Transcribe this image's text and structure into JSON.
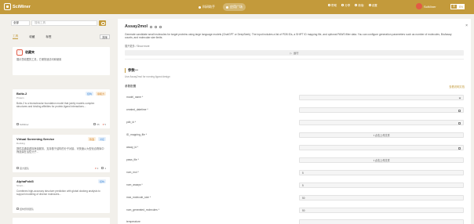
{
  "header": {
    "logo_text": "SciMiner",
    "nav": [
      {
        "label": "科研助手",
        "active": false
      },
      {
        "label": "应用广场",
        "active": true
      }
    ],
    "top_links": [
      "帮助",
      "分享",
      "新版",
      "设置"
    ],
    "user_name": "SciMiner",
    "lang": [
      "中",
      "EN"
    ]
  },
  "sidebar": {
    "search_select": "全部",
    "search_placeholder": "搜索工具",
    "tabs": [
      {
        "label": "工具",
        "active": true
      },
      {
        "label": "收藏",
        "active": false
      },
      {
        "label": "标签",
        "active": false
      }
    ],
    "sort_label": "排序",
    "favorites_card": {
      "title": "收藏夹",
      "desc": "展示您收藏的工具，方便快速访问和使用"
    },
    "cards": [
      {
        "title": "Boltz-2",
        "subtitle": "Protein",
        "desc": "Boltz-2 is a biomolecular foundation model that jointly models complex structures and binding affinities for protein-ligand interactions...",
        "tags": [
          "结构",
          "亲和力"
        ],
        "author": "SciMiner",
        "likes": "55",
        "favs": "5"
      },
      {
        "title": "Virtual Screening Service",
        "subtitle": "Docking",
        "desc": "提供高通量虚拟筛选服务，支持基于结构的分子对接，可快速从大型化合物库中筛选潜在活性分子...",
        "tags": [
          "筛选",
          "对接"
        ],
        "author": "官方团队",
        "likes": "3",
        "favs": "3"
      },
      {
        "title": "AlphaFold3",
        "subtitle": "Struct...",
        "desc": "Combines high-accuracy structure prediction with global docking analysis to support modeling of diverse molecules...",
        "tags": [
          "结构"
        ],
        "author": "结构预测团队",
        "likes": "",
        "favs": ""
      }
    ]
  },
  "main": {
    "title": "Assay2mol",
    "description": "Generate candidate small molecules for target proteins using large language models (ChatGPT or DeepSeek). The input includes a list of PDB IDs, a SHIFT ID mapping file, and optional PAWS filter data. You can configure generation parameters such as number of molecules, BioAssay counts, and molecular size limits.",
    "desc_more": "展开更多 / Show more",
    "run_button": "运行",
    "section_title": "参数一",
    "section_sub": "Use Assay2mol for running ligand design",
    "params_label": "参数配置",
    "help_link": "查看说明文档",
    "fields": [
      {
        "label": "model_name *",
        "value": "",
        "type": "select"
      },
      {
        "label": "created_datetime *",
        "value": "",
        "type": "date"
      },
      {
        "label": "pdb_id *",
        "value": "",
        "type": "select"
      },
      {
        "label": "ID_mapping_file *",
        "value": "点击上传文件",
        "type": "upload"
      },
      {
        "label": "assay_id *",
        "value": "",
        "type": "select"
      },
      {
        "label": "paws_file *",
        "value": "点击上传文件",
        "type": "upload"
      },
      {
        "label": "num_mol *",
        "value": "5",
        "type": "number"
      },
      {
        "label": "num_assays *",
        "value": "5",
        "type": "number"
      },
      {
        "label": "max_molecule_size *",
        "value": "50",
        "type": "number"
      },
      {
        "label": "num_generated_molecules *",
        "value": "50",
        "type": "number"
      },
      {
        "label": "temperature",
        "value": "",
        "type": "number"
      }
    ]
  }
}
